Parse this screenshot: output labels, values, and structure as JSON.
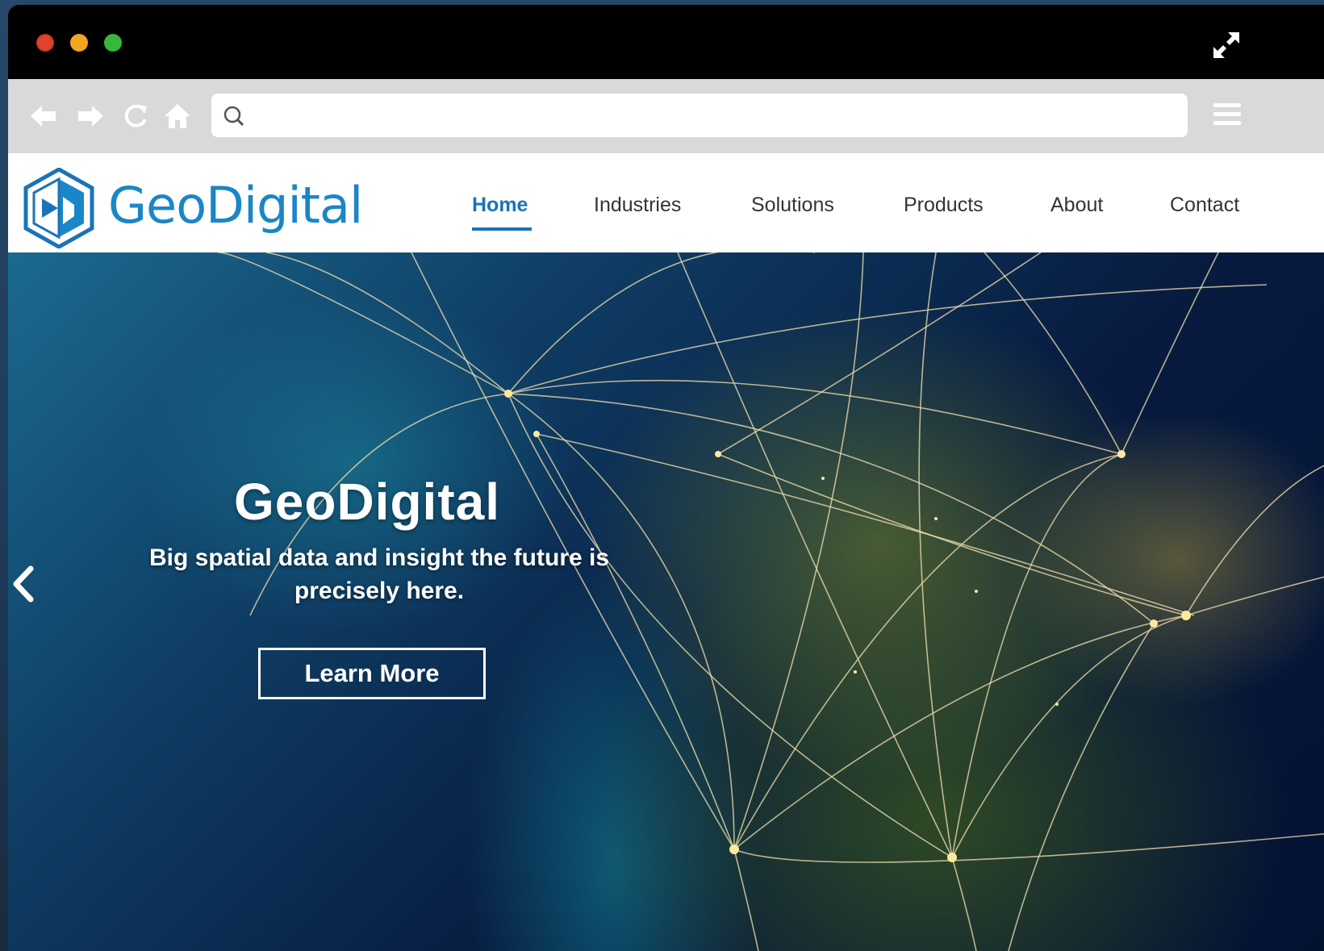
{
  "browser": {
    "address_placeholder": "",
    "address_value": ""
  },
  "site": {
    "logo_text": "GeoDigital",
    "nav": [
      {
        "label": "Home",
        "active": true
      },
      {
        "label": "Industries"
      },
      {
        "label": "Solutions"
      },
      {
        "label": "Products"
      },
      {
        "label": "About"
      },
      {
        "label": "Contact"
      }
    ]
  },
  "hero": {
    "title": "GeoDigital",
    "subtitle": "Big spatial data and insight the future is precisely here.",
    "button_label": "Learn More"
  },
  "colors": {
    "brand_blue": "#1a86c7",
    "nav_active": "#1a73b8",
    "toolbar": "#d9d9d9"
  },
  "icons": {
    "window_controls": [
      "close-dot",
      "minimize-dot",
      "zoom-dot"
    ],
    "toolbar": [
      "back-arrow-icon",
      "forward-arrow-icon",
      "reload-icon",
      "home-icon",
      "search-icon",
      "hamburger-menu-icon"
    ],
    "hero": [
      "chevron-left-icon"
    ]
  }
}
